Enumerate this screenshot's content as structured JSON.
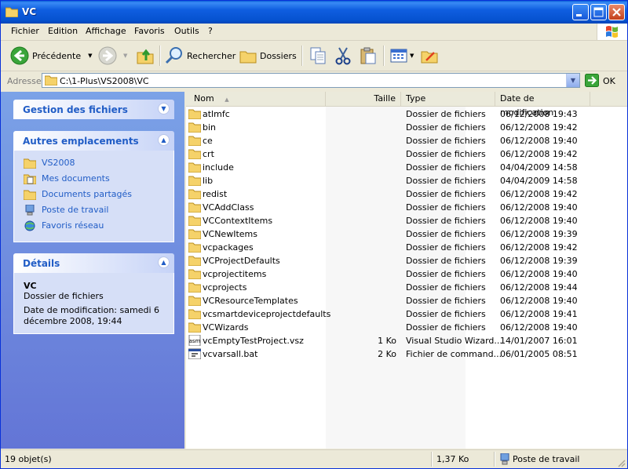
{
  "window": {
    "title": "VC"
  },
  "menu": [
    "Fichier",
    "Edition",
    "Affichage",
    "Favoris",
    "Outils",
    "?"
  ],
  "toolbar": {
    "back_label": "Précédente",
    "search_label": "Rechercher",
    "folders_label": "Dossiers"
  },
  "address": {
    "label": "Adresse",
    "path": "C:\\1-Plus\\VS2008\\VC",
    "go_label": "OK"
  },
  "sidebar": {
    "files_panel": {
      "title": "Gestion des fichiers"
    },
    "places_panel": {
      "title": "Autres emplacements",
      "items": [
        {
          "label": "VS2008",
          "icon": "folder-icon"
        },
        {
          "label": "Mes documents",
          "icon": "documents-icon"
        },
        {
          "label": "Documents partagés",
          "icon": "shared-folder-icon"
        },
        {
          "label": "Poste de travail",
          "icon": "computer-icon"
        },
        {
          "label": "Favoris réseau",
          "icon": "network-icon"
        }
      ]
    },
    "details_panel": {
      "title": "Détails",
      "name": "VC",
      "type": "Dossier de fichiers",
      "modified": "Date de modification: samedi 6 décembre 2008, 19:44"
    }
  },
  "columns": {
    "name": "Nom",
    "size": "Taille",
    "type": "Type",
    "date": "Date de modification"
  },
  "files": [
    {
      "name": "atlmfc",
      "size": "",
      "type": "Dossier de fichiers",
      "date": "06/12/2008 19:43",
      "icon": "folder-icon"
    },
    {
      "name": "bin",
      "size": "",
      "type": "Dossier de fichiers",
      "date": "06/12/2008 19:42",
      "icon": "folder-icon"
    },
    {
      "name": "ce",
      "size": "",
      "type": "Dossier de fichiers",
      "date": "06/12/2008 19:40",
      "icon": "folder-icon"
    },
    {
      "name": "crt",
      "size": "",
      "type": "Dossier de fichiers",
      "date": "06/12/2008 19:42",
      "icon": "folder-icon"
    },
    {
      "name": "include",
      "size": "",
      "type": "Dossier de fichiers",
      "date": "04/04/2009 14:58",
      "icon": "folder-icon"
    },
    {
      "name": "lib",
      "size": "",
      "type": "Dossier de fichiers",
      "date": "04/04/2009 14:58",
      "icon": "folder-icon"
    },
    {
      "name": "redist",
      "size": "",
      "type": "Dossier de fichiers",
      "date": "06/12/2008 19:42",
      "icon": "folder-icon"
    },
    {
      "name": "VCAddClass",
      "size": "",
      "type": "Dossier de fichiers",
      "date": "06/12/2008 19:40",
      "icon": "folder-icon"
    },
    {
      "name": "VCContextItems",
      "size": "",
      "type": "Dossier de fichiers",
      "date": "06/12/2008 19:40",
      "icon": "folder-icon"
    },
    {
      "name": "VCNewItems",
      "size": "",
      "type": "Dossier de fichiers",
      "date": "06/12/2008 19:39",
      "icon": "folder-icon"
    },
    {
      "name": "vcpackages",
      "size": "",
      "type": "Dossier de fichiers",
      "date": "06/12/2008 19:42",
      "icon": "folder-icon"
    },
    {
      "name": "VCProjectDefaults",
      "size": "",
      "type": "Dossier de fichiers",
      "date": "06/12/2008 19:39",
      "icon": "folder-icon"
    },
    {
      "name": "vcprojectitems",
      "size": "",
      "type": "Dossier de fichiers",
      "date": "06/12/2008 19:40",
      "icon": "folder-icon"
    },
    {
      "name": "vcprojects",
      "size": "",
      "type": "Dossier de fichiers",
      "date": "06/12/2008 19:44",
      "icon": "folder-icon"
    },
    {
      "name": "VCResourceTemplates",
      "size": "",
      "type": "Dossier de fichiers",
      "date": "06/12/2008 19:40",
      "icon": "folder-icon"
    },
    {
      "name": "vcsmartdeviceprojectdefaults",
      "size": "",
      "type": "Dossier de fichiers",
      "date": "06/12/2008 19:41",
      "icon": "folder-icon"
    },
    {
      "name": "VCWizards",
      "size": "",
      "type": "Dossier de fichiers",
      "date": "06/12/2008 19:40",
      "icon": "folder-icon"
    },
    {
      "name": "vcEmptyTestProject.vsz",
      "size": "1 Ko",
      "type": "Visual Studio Wizard...",
      "date": "14/01/2007 16:01",
      "icon": "asm-file-icon"
    },
    {
      "name": "vcvarsall.bat",
      "size": "2 Ko",
      "type": "Fichier de command...",
      "date": "06/01/2005 08:51",
      "icon": "batch-file-icon"
    }
  ],
  "status": {
    "count": "19 objet(s)",
    "size": "1,37 Ko",
    "location": "Poste de travail"
  },
  "colors": {
    "title_blue": "#0a5fd8",
    "link_blue": "#215dc6",
    "folder_yellow": "#f5d26a"
  }
}
